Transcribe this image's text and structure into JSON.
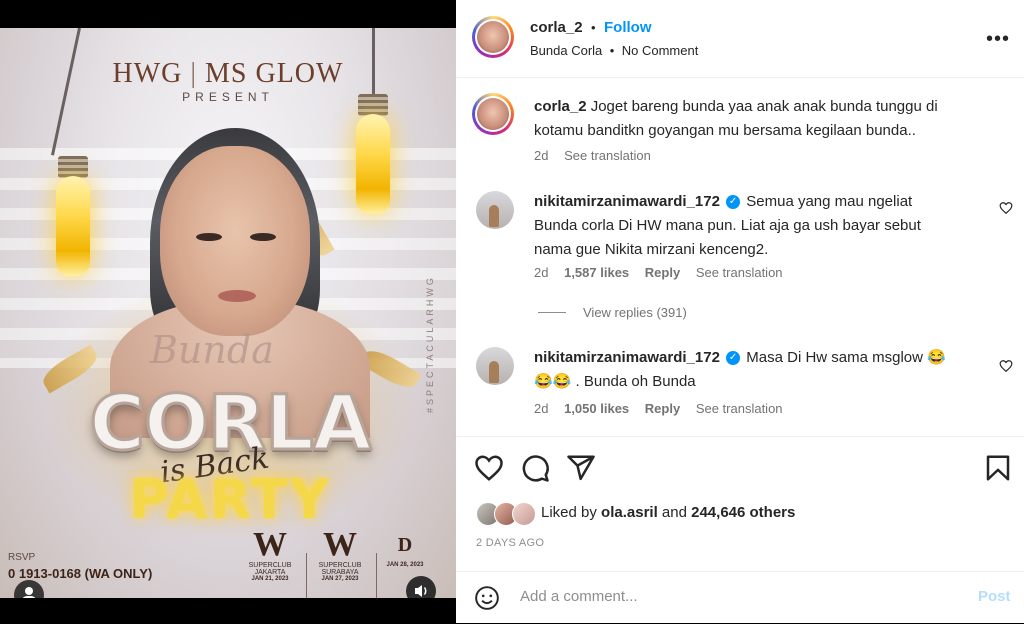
{
  "post_image": {
    "brand_left": "HWG",
    "brand_right": "MS GLOW",
    "present": "PRESENT",
    "script_title": "Bunda",
    "main_title": "CORLA",
    "is_back": "is Back",
    "party": "PARTY",
    "hashtag": "#SPECTACULARHWG",
    "rsvp": "RSVP",
    "phone": "0 1913-0168 (WA ONLY)",
    "venues": [
      {
        "logo": "W",
        "name": "SUPERCLUB",
        "city": "JAKARTA",
        "date": "JAN 21, 2023"
      },
      {
        "logo": "W",
        "name": "SUPERCLUB",
        "city": "SURABAYA",
        "date": "JAN 27, 2023"
      },
      {
        "logo": "",
        "name": "D",
        "city": "",
        "date": "JAN 28, 2023"
      }
    ]
  },
  "header": {
    "username": "corla_2",
    "dot": "•",
    "follow": "Follow",
    "subtitle_left": "Bunda Corla",
    "subtitle_dot": "•",
    "subtitle_right": "No Comment",
    "more": "•••"
  },
  "caption": {
    "username": "corla_2",
    "text": "Joget bareng bunda yaa anak anak bunda tunggu di kotamu banditkn goyangan mu bersama kegilaan bunda..",
    "time": "2d",
    "translate": "See translation"
  },
  "comments": [
    {
      "username": "nikitamirzanimawardi_172",
      "verified": "✓",
      "text": "Semua yang mau ngeliat Bunda corla Di HW mana pun. Liat aja ga ush bayar sebut nama gue Nikita mirzani kenceng2.",
      "time": "2d",
      "likes": "1,587 likes",
      "reply": "Reply",
      "translate": "See translation",
      "view_replies": "View replies (391)"
    },
    {
      "username": "nikitamirzanimawardi_172",
      "verified": "✓",
      "text": "Masa Di Hw sama msglow 😂😂😂 . Bunda oh Bunda",
      "time": "2d",
      "likes": "1,050 likes",
      "reply": "Reply",
      "translate": "See translation"
    }
  ],
  "likes_line": {
    "prefix": "Liked by",
    "user": "ola.asril",
    "middle": "and",
    "count": "244,646 others"
  },
  "time_ago": "2 DAYS AGO",
  "add_comment": {
    "placeholder": "Add a comment...",
    "post": "Post"
  },
  "icons": [
    "heart-icon",
    "comment-icon",
    "share-icon",
    "bookmark-icon",
    "emoji-icon",
    "user-tag-icon",
    "volume-icon"
  ]
}
